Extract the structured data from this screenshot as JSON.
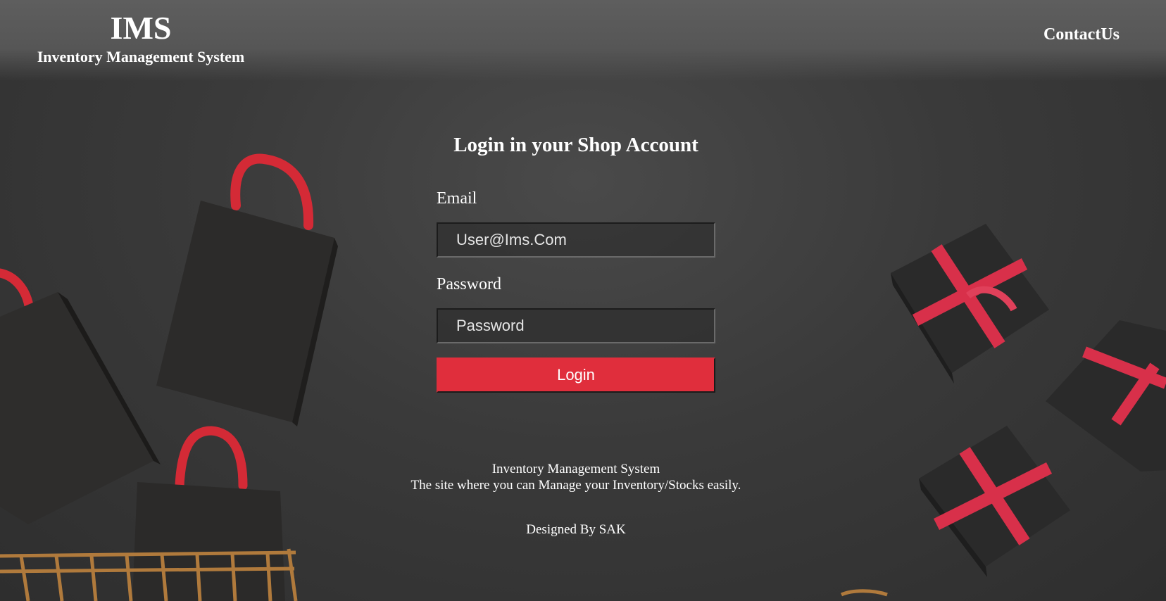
{
  "header": {
    "brand_title": "IMS",
    "brand_subtitle": "Inventory Management System",
    "contact_label": "ContactUs"
  },
  "login": {
    "heading": "Login in your Shop Account",
    "email_label": "Email",
    "email_placeholder": "User@Ims.Com",
    "password_label": "Password",
    "password_placeholder": "Password",
    "button_label": "Login"
  },
  "footer": {
    "line1": "Inventory Management System",
    "line2": "The site where you can Manage your Inventory/Stocks easily.",
    "credit": "Designed By SAK"
  },
  "colors": {
    "accent": "#e02e3c",
    "background": "#3a3a3a",
    "text": "#ffffff"
  }
}
